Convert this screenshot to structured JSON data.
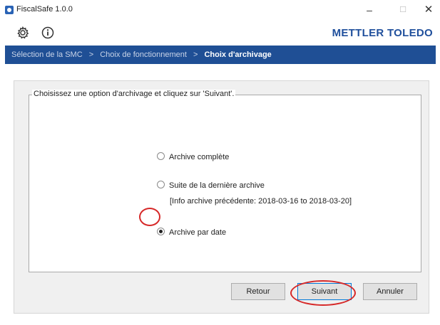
{
  "window": {
    "title": "FiscalSafe 1.0.0",
    "min_glyph": "–",
    "max_glyph": "☐",
    "close_glyph": "✕"
  },
  "toolbar": {
    "settings_icon": "gear-icon",
    "info_icon": "info-icon",
    "brand": "METTLER TOLEDO"
  },
  "breadcrumb": {
    "steps": [
      "Sélection de la SMC",
      "Choix de fonctionnement",
      "Choix d'archivage"
    ],
    "separator": ">",
    "current_index": 2
  },
  "group": {
    "legend": "Choisissez une option d'archivage et cliquez sur 'Suivant'."
  },
  "options": {
    "full": "Archive complète",
    "continue": "Suite de la dernière archive",
    "previous_info": "[Info archive précédente: 2018-03-16 to 2018-03-20]",
    "by_date": "Archive par date",
    "selected": "by_date"
  },
  "buttons": {
    "back": "Retour",
    "next": "Suivant",
    "cancel": "Annuler"
  },
  "colors": {
    "brand": "#1f4f9c",
    "breadcrumb_bg": "#1f4f95",
    "annotation": "#d62828"
  }
}
